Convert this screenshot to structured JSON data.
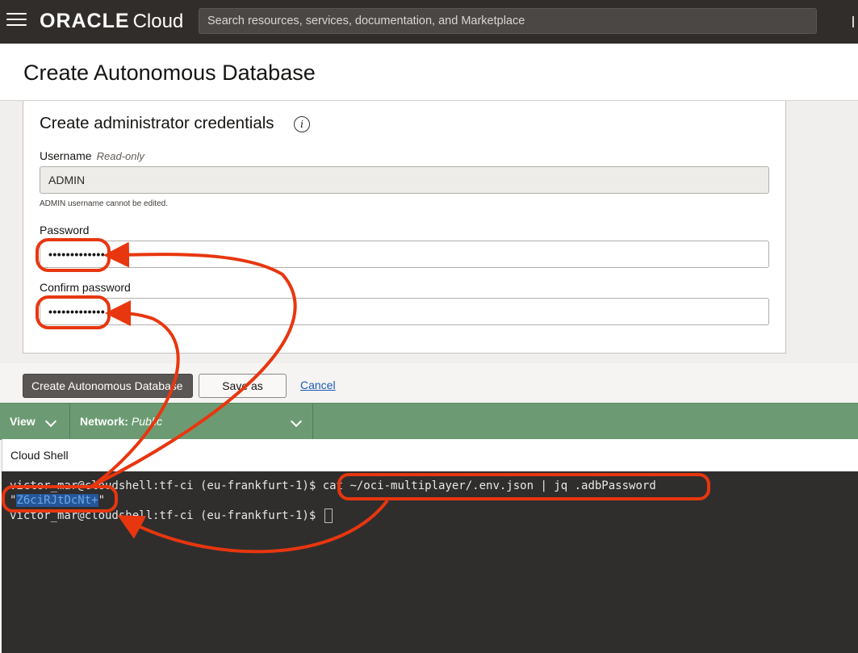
{
  "topbar": {
    "brand": "ORACLE",
    "product": "Cloud",
    "search_placeholder": "Search resources, services, documentation, and Marketplace"
  },
  "page": {
    "title": "Create Autonomous Database"
  },
  "credentials": {
    "section_title": "Create administrator credentials",
    "username_label": "Username",
    "username_note": "Read-only",
    "username_value": "ADMIN",
    "username_hint": "ADMIN username cannot be edited.",
    "password_label": "Password",
    "password_mask": "•••••••••••••",
    "confirm_label": "Confirm password",
    "confirm_mask": "•••••••••••••"
  },
  "actions": {
    "create": "Create Autonomous Database",
    "save_stack": "Save as stack",
    "cancel": "Cancel"
  },
  "shell_toolbar": {
    "view": "View",
    "network_label": "Network:",
    "network_value": "Public"
  },
  "cloud_shell": {
    "title": "Cloud Shell",
    "line1_prompt": "victor_mar@cloudshell:tf-ci (eu-frankfurt-1)$ ",
    "line1_command": "cat ~/oci-multiplayer/.env.json | jq .adbPassword",
    "line2_quote_open": "\"",
    "line2_value": "Z6ciRJtDcNt+",
    "line2_quote_close": "\"",
    "line3_prompt": "victor_mar@cloudshell:tf-ci (eu-frankfurt-1)$ "
  },
  "colors": {
    "topbar": "#312d2a",
    "annotation": "#e8360f",
    "shell_bar": "#6c9b73",
    "terminal_bg": "#2f2e2d"
  }
}
